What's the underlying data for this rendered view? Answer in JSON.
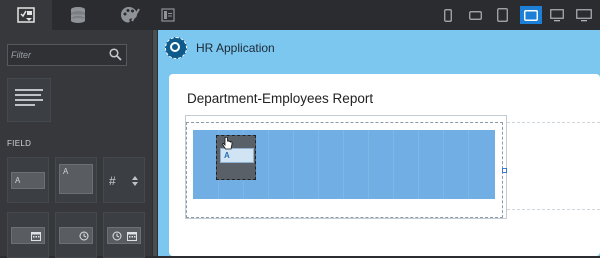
{
  "sidebar": {
    "tabs": [
      {
        "icon": "toolbox-icon",
        "active": true
      },
      {
        "icon": "database-icon",
        "active": false
      },
      {
        "icon": "palette-icon",
        "active": false
      }
    ],
    "filter": {
      "placeholder": "Filter",
      "value": ""
    },
    "section_label": "FIELD",
    "palette_items": [
      {
        "name": "text-field",
        "label": "A"
      },
      {
        "name": "text-area",
        "label": "A"
      },
      {
        "name": "number-field",
        "label": "#"
      },
      {
        "name": "date-field"
      },
      {
        "name": "time-field"
      },
      {
        "name": "datetime-field"
      }
    ]
  },
  "toolbar": {
    "devices": [
      "phone-portrait",
      "phone-landscape",
      "tablet-portrait",
      "tablet-landscape",
      "desktop",
      "wide-desktop"
    ],
    "active_device": "tablet-landscape"
  },
  "app": {
    "title": "HR Application"
  },
  "report": {
    "title": "Department-Employees Report"
  },
  "drag_chip": {
    "label": "A"
  },
  "colors": {
    "accent": "#1e7fd6",
    "preview_bg": "#7cc7ef",
    "grid": "#71aee4",
    "panel": "#36383b"
  }
}
